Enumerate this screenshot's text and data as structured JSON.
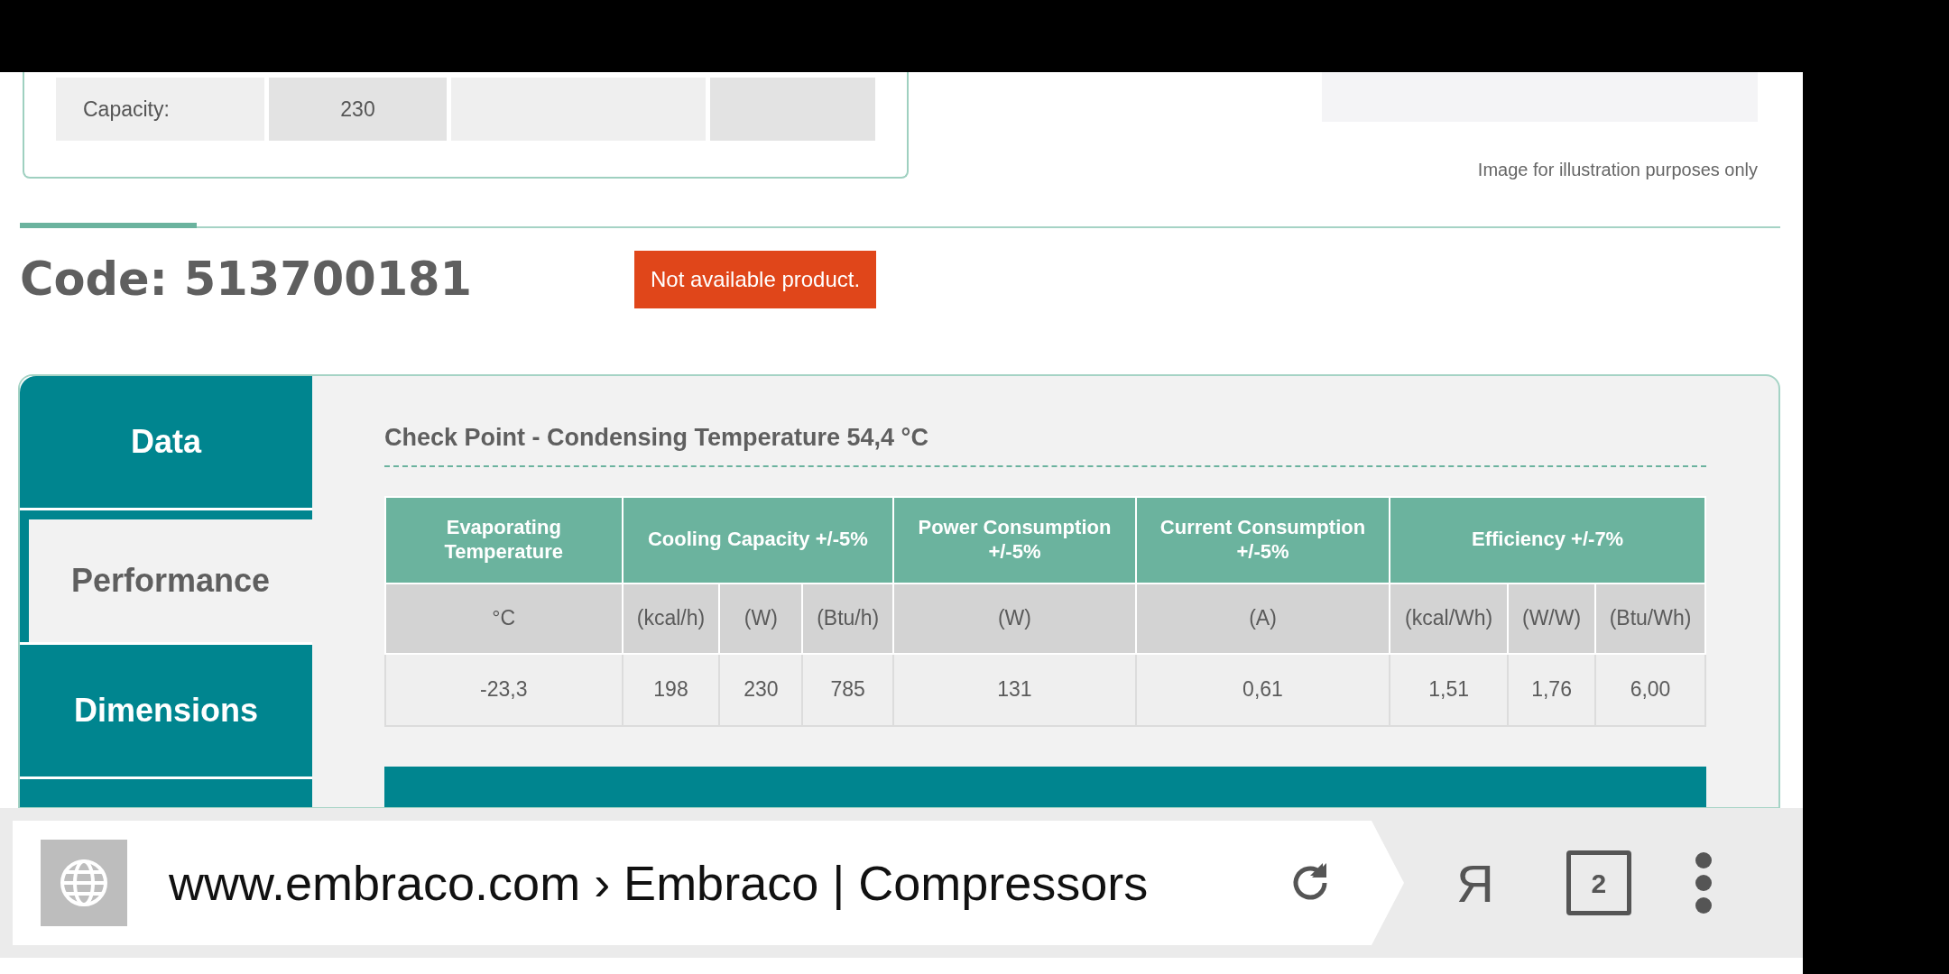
{
  "spec_table": {
    "rows": [
      {
        "label": "Capacity:",
        "value": "230"
      }
    ]
  },
  "image_caption": "Image for illustration purposes only",
  "product": {
    "code": "Code: 513700181",
    "status": "Not available product."
  },
  "side_tabs": [
    {
      "label": "Data",
      "selected": false
    },
    {
      "label": "Performance",
      "selected": true
    },
    {
      "label": "Dimensions",
      "selected": false
    },
    {
      "selected": false
    }
  ],
  "section_title": "Check Point - Condensing Temperature 54,4 °C",
  "performance_table": {
    "groups": [
      {
        "label": "Evaporating Temperature",
        "units": [
          "°C"
        ]
      },
      {
        "label": "Cooling Capacity +/-5%",
        "units": [
          "(kcal/h)",
          "(W)",
          "(Btu/h)"
        ]
      },
      {
        "label": "Power Consumption +/-5%",
        "units": [
          "(W)"
        ]
      },
      {
        "label": "Current Consumption +/-5%",
        "units": [
          "(A)"
        ]
      },
      {
        "label": "Efficiency +/-7%",
        "units": [
          "(kcal/Wh)",
          "(W/W)",
          "(Btu/Wh)"
        ]
      }
    ],
    "rows": [
      [
        "-23,3",
        "198",
        "230",
        "785",
        "131",
        "0,61",
        "1,51",
        "1,76",
        "6,00"
      ]
    ]
  },
  "browser_bar": {
    "url": "www.embraco.com › Embraco | Compressors",
    "yandex_button": "Я",
    "tab_count": "2"
  }
}
